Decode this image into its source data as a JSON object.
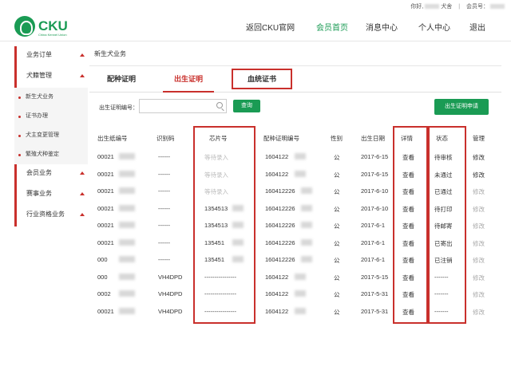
{
  "topbar": {
    "greeting": "你好,",
    "greeting_suffix": "犬舍",
    "sep": "|",
    "member_no_label": "会员号："
  },
  "header": {
    "logo_text": "CKU",
    "logo_sub": "China Kennel Union",
    "nav": [
      "返回CKU官网",
      "会员首页",
      "消息中心",
      "个人中心",
      "退出"
    ],
    "active_nav": 1
  },
  "sidebar": {
    "groups": [
      {
        "label": "业务订单",
        "subs": []
      },
      {
        "label": "犬籍管理",
        "subs": [
          "新生犬业务",
          "证书办理",
          "犬主变更管理",
          "繁殖犬种鉴定"
        ]
      },
      {
        "label": "会员业务",
        "subs": []
      },
      {
        "label": "赛事业务",
        "subs": []
      },
      {
        "label": "行业资格业务",
        "subs": []
      }
    ]
  },
  "main": {
    "breadcrumb": "新生犬业务",
    "tabs": [
      "配种证明",
      "出生证明",
      "血统证书"
    ],
    "active_tab": 1,
    "search_label": "出生证明编号：",
    "search_placeholder": "",
    "search_button": "查询",
    "apply_button": "出生证明申请"
  },
  "table": {
    "headers": [
      "出生纸编号",
      "识别码",
      "芯片号",
      "配种证明编号",
      "性别",
      "出生日期",
      "详情",
      "状态",
      "管理"
    ],
    "rows": [
      {
        "no": "00021",
        "code": "------",
        "chip": "等待录入",
        "chip_muted": true,
        "breed": "1604122",
        "sex": "公",
        "date": "2017-6-15",
        "detail": "查看",
        "status": "待审核",
        "manage": "修改",
        "manage_dim": false
      },
      {
        "no": "00021",
        "code": "------",
        "chip": "等待录入",
        "chip_muted": true,
        "breed": "1604122",
        "sex": "公",
        "date": "2017-6-15",
        "detail": "查看",
        "status": "未通过",
        "manage": "修改",
        "manage_dim": false
      },
      {
        "no": "00021",
        "code": "------",
        "chip": "等待录入",
        "chip_muted": true,
        "breed": "160412226",
        "sex": "公",
        "date": "2017-6-10",
        "detail": "查看",
        "status": "已通过",
        "manage": "修改",
        "manage_dim": true
      },
      {
        "no": "00021",
        "code": "------",
        "chip": "1354513",
        "chip_muted": false,
        "breed": "160412226",
        "sex": "公",
        "date": "2017-6-10",
        "detail": "查看",
        "status": "待打印",
        "manage": "修改",
        "manage_dim": true
      },
      {
        "no": "00021",
        "code": "------",
        "chip": "1354513",
        "chip_muted": false,
        "breed": "160412226",
        "sex": "公",
        "date": "2017-6-1",
        "detail": "查看",
        "status": "待邮寄",
        "manage": "修改",
        "manage_dim": true
      },
      {
        "no": "00021",
        "code": "------",
        "chip": "135451",
        "chip_muted": false,
        "breed": "160412226",
        "sex": "公",
        "date": "2017-6-1",
        "detail": "查看",
        "status": "已寄出",
        "manage": "修改",
        "manage_dim": true
      },
      {
        "no": "000",
        "code": "------",
        "chip": "135451",
        "chip_muted": false,
        "breed": "160412226",
        "sex": "公",
        "date": "2017-6-1",
        "detail": "查看",
        "status": "已注销",
        "manage": "修改",
        "manage_dim": true
      },
      {
        "no": "000",
        "code": "VH4DPD",
        "chip": "----------------",
        "chip_muted": false,
        "breed": "1604122",
        "sex": "公",
        "date": "2017-5-15",
        "detail": "查看",
        "status": "-------",
        "manage": "修改",
        "manage_dim": true
      },
      {
        "no": "0002",
        "code": "VH4DPD",
        "chip": "----------------",
        "chip_muted": false,
        "breed": "1604122",
        "sex": "公",
        "date": "2017-5-31",
        "detail": "查看",
        "status": "-------",
        "manage": "修改",
        "manage_dim": true
      },
      {
        "no": "00021",
        "code": "VH4DPD",
        "chip": "----------------",
        "chip_muted": false,
        "breed": "1604122",
        "sex": "公",
        "date": "2017-5-31",
        "detail": "查看",
        "status": "-------",
        "manage": "修改",
        "manage_dim": true
      }
    ]
  }
}
